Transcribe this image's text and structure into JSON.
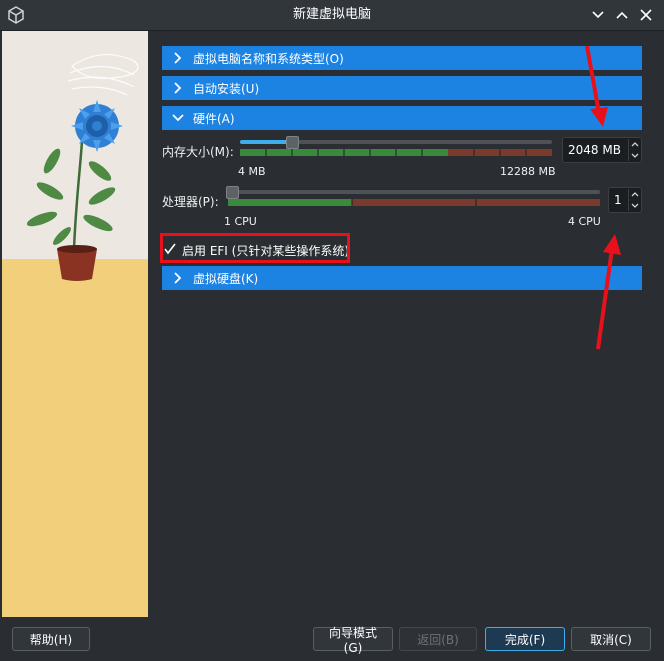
{
  "window": {
    "title": "新建虚拟电脑",
    "icons": [
      "virtualbox-icon",
      "chevron-down-icon",
      "chevron-up-icon",
      "close-icon"
    ]
  },
  "sections": {
    "name_os": {
      "label": "虚拟电脑名称和系统类型(O)",
      "expanded": false
    },
    "unattended": {
      "label": "自动安装(U)",
      "expanded": false
    },
    "hardware": {
      "label": "硬件(A)",
      "expanded": true
    },
    "disk": {
      "label": "虚拟硬盘(K)",
      "expanded": false
    }
  },
  "hardware": {
    "memory_label": "内存大小(M):",
    "memory_value": "2048 MB",
    "memory_min": "4 MB",
    "memory_max": "12288 MB",
    "memory_fraction": 0.167,
    "cpu_label": "处理器(P):",
    "cpu_value": "1",
    "cpu_min": "1 CPU",
    "cpu_max": "4 CPU",
    "cpu_fraction": 0,
    "efi_label": "启用 EFI (只针对某些操作系统)",
    "efi_checked": true
  },
  "buttons": {
    "help": "帮助(H)",
    "guided": "向导模式(G)",
    "back": "返回(B)",
    "finish": "完成(F)",
    "cancel": "取消(C)"
  },
  "colors": {
    "accent": "#1d83e3",
    "highlight": "#e8111b",
    "scale_green": "#3a8a3e",
    "scale_red": "#7a3a2c"
  }
}
